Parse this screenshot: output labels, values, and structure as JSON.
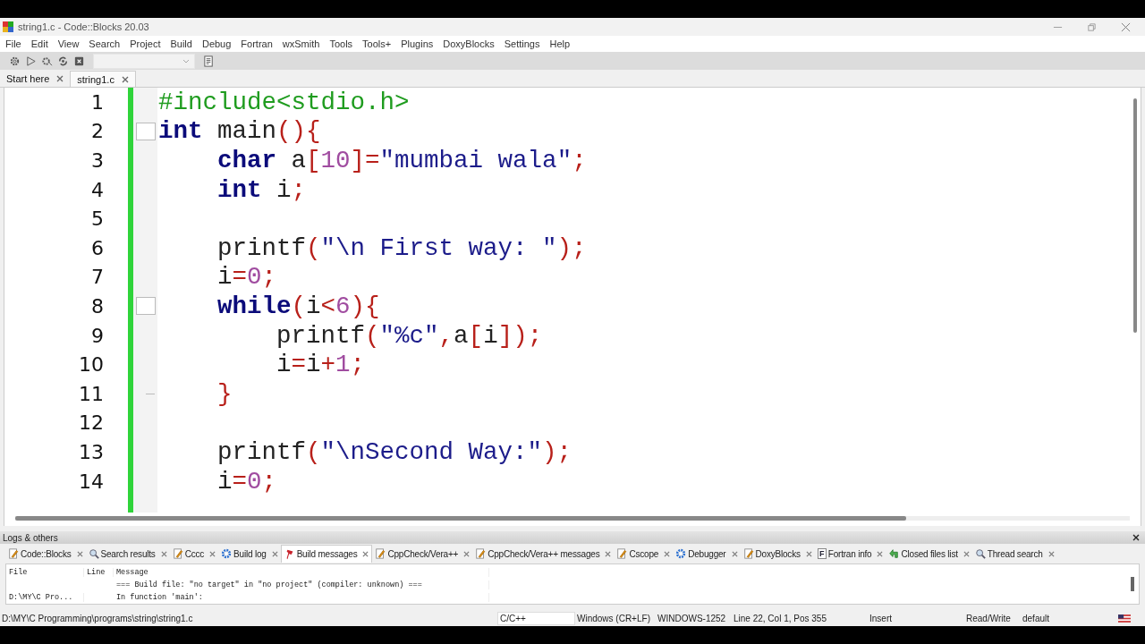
{
  "window": {
    "title": "string1.c - Code::Blocks 20.03"
  },
  "menu": [
    "File",
    "Edit",
    "View",
    "Search",
    "Project",
    "Build",
    "Debug",
    "Fortran",
    "wxSmith",
    "Tools",
    "Tools+",
    "Plugins",
    "DoxyBlocks",
    "Settings",
    "Help"
  ],
  "editor_tabs": [
    {
      "label": "Start here",
      "selected": false
    },
    {
      "label": "string1.c",
      "selected": true
    }
  ],
  "code_lines": [
    {
      "number": "1",
      "kind": "plain",
      "tokens": [
        {
          "kind": "pp",
          "text": "#include<stdio.h>"
        }
      ]
    },
    {
      "number": "2",
      "kind": "foldstart",
      "tokens": [
        {
          "kind": "kw",
          "text": "int"
        },
        {
          "kind": "id",
          "text": " main"
        },
        {
          "kind": "op",
          "text": "(){"
        }
      ]
    },
    {
      "number": "3",
      "kind": "plain",
      "tokens": [
        {
          "kind": "kw",
          "text": "    char"
        },
        {
          "kind": "id",
          "text": " a"
        },
        {
          "kind": "op",
          "text": "["
        },
        {
          "kind": "num",
          "text": "10"
        },
        {
          "kind": "op",
          "text": "]="
        },
        {
          "kind": "str",
          "text": "\"mumbai wala\""
        },
        {
          "kind": "op",
          "text": ";"
        }
      ]
    },
    {
      "number": "4",
      "kind": "plain",
      "tokens": [
        {
          "kind": "kw",
          "text": "    int"
        },
        {
          "kind": "id",
          "text": " i"
        },
        {
          "kind": "op",
          "text": ";"
        }
      ]
    },
    {
      "number": "5",
      "kind": "plain"
    },
    {
      "number": "6",
      "kind": "plain",
      "tokens": [
        {
          "kind": "id",
          "text": "    printf"
        },
        {
          "kind": "op",
          "text": "("
        },
        {
          "kind": "str",
          "text": "\"\\n First way: \""
        },
        {
          "kind": "op",
          "text": ");"
        }
      ]
    },
    {
      "number": "7",
      "kind": "plain",
      "tokens": [
        {
          "kind": "id",
          "text": "    i"
        },
        {
          "kind": "op",
          "text": "="
        },
        {
          "kind": "num",
          "text": "0"
        },
        {
          "kind": "op",
          "text": ";"
        }
      ]
    },
    {
      "number": "8",
      "kind": "foldstart",
      "tokens": [
        {
          "kind": "kw",
          "text": "    while"
        },
        {
          "kind": "op",
          "text": "("
        },
        {
          "kind": "id",
          "text": "i"
        },
        {
          "kind": "op",
          "text": "<"
        },
        {
          "kind": "num",
          "text": "6"
        },
        {
          "kind": "op",
          "text": "){"
        }
      ]
    },
    {
      "number": "9",
      "kind": "plain",
      "tokens": [
        {
          "kind": "id",
          "text": "        printf"
        },
        {
          "kind": "op",
          "text": "("
        },
        {
          "kind": "str",
          "text": "\"%c\""
        },
        {
          "kind": "op",
          "text": ","
        },
        {
          "kind": "id",
          "text": "a"
        },
        {
          "kind": "op",
          "text": "["
        },
        {
          "kind": "id",
          "text": "i"
        },
        {
          "kind": "op",
          "text": "]);"
        }
      ]
    },
    {
      "number": "10",
      "kind": "plain",
      "tokens": [
        {
          "kind": "id",
          "text": "        i"
        },
        {
          "kind": "op",
          "text": "="
        },
        {
          "kind": "id",
          "text": "i"
        },
        {
          "kind": "op",
          "text": "+"
        },
        {
          "kind": "num",
          "text": "1"
        },
        {
          "kind": "op",
          "text": ";"
        }
      ]
    },
    {
      "number": "11",
      "kind": "foldend",
      "tokens": [
        {
          "kind": "op",
          "text": "    }"
        }
      ]
    },
    {
      "number": "12",
      "kind": "plain"
    },
    {
      "number": "13",
      "kind": "plain",
      "tokens": [
        {
          "kind": "id",
          "text": "    printf"
        },
        {
          "kind": "op",
          "text": "("
        },
        {
          "kind": "str",
          "text": "\"\\nSecond Way:\""
        },
        {
          "kind": "op",
          "text": ");"
        }
      ]
    },
    {
      "number": "14",
      "kind": "plain",
      "tokens": [
        {
          "kind": "id",
          "text": "    i"
        },
        {
          "kind": "op",
          "text": "="
        },
        {
          "kind": "num",
          "text": "0"
        },
        {
          "kind": "op",
          "text": ";"
        }
      ]
    }
  ],
  "logs_panel": {
    "title": "Logs & others",
    "tabs": [
      {
        "label": "Code::Blocks",
        "kind": "pencil",
        "selected": false
      },
      {
        "label": "Search results",
        "kind": "search",
        "selected": false
      },
      {
        "label": "Cccc",
        "kind": "pencil",
        "selected": false
      },
      {
        "label": "Build log",
        "kind": "gear",
        "selected": false
      },
      {
        "label": "Build messages",
        "kind": "pin",
        "selected": true
      },
      {
        "label": "CppCheck/Vera++",
        "kind": "pencil",
        "selected": false
      },
      {
        "label": "CppCheck/Vera++ messages",
        "kind": "pencil",
        "selected": false
      },
      {
        "label": "Cscope",
        "kind": "pencil",
        "selected": false
      },
      {
        "label": "Debugger",
        "kind": "gear",
        "selected": false
      },
      {
        "label": "DoxyBlocks",
        "kind": "pencil",
        "selected": false
      },
      {
        "label": "Fortran info",
        "kind": "letter",
        "glyph": "F",
        "selected": false
      },
      {
        "label": "Closed files list",
        "kind": "arrow",
        "selected": false
      },
      {
        "label": "Thread search",
        "kind": "search",
        "selected": false
      }
    ],
    "columns": [
      "File",
      "Line",
      "Message"
    ],
    "rows": [
      [
        "",
        "",
        "=== Build file: \"no target\" in \"no project\" (compiler: unknown) ==="
      ],
      [
        "D:\\MY\\C Pro...",
        "",
        "In function 'main':"
      ]
    ]
  },
  "status_bar": [
    "D:\\MY\\C Programming\\programs\\string\\string1.c",
    "C/C++",
    "Windows (CR+LF)",
    "WINDOWS-1252",
    "Line 22, Col 1, Pos 355",
    "Insert",
    "Read/Write",
    "default"
  ]
}
